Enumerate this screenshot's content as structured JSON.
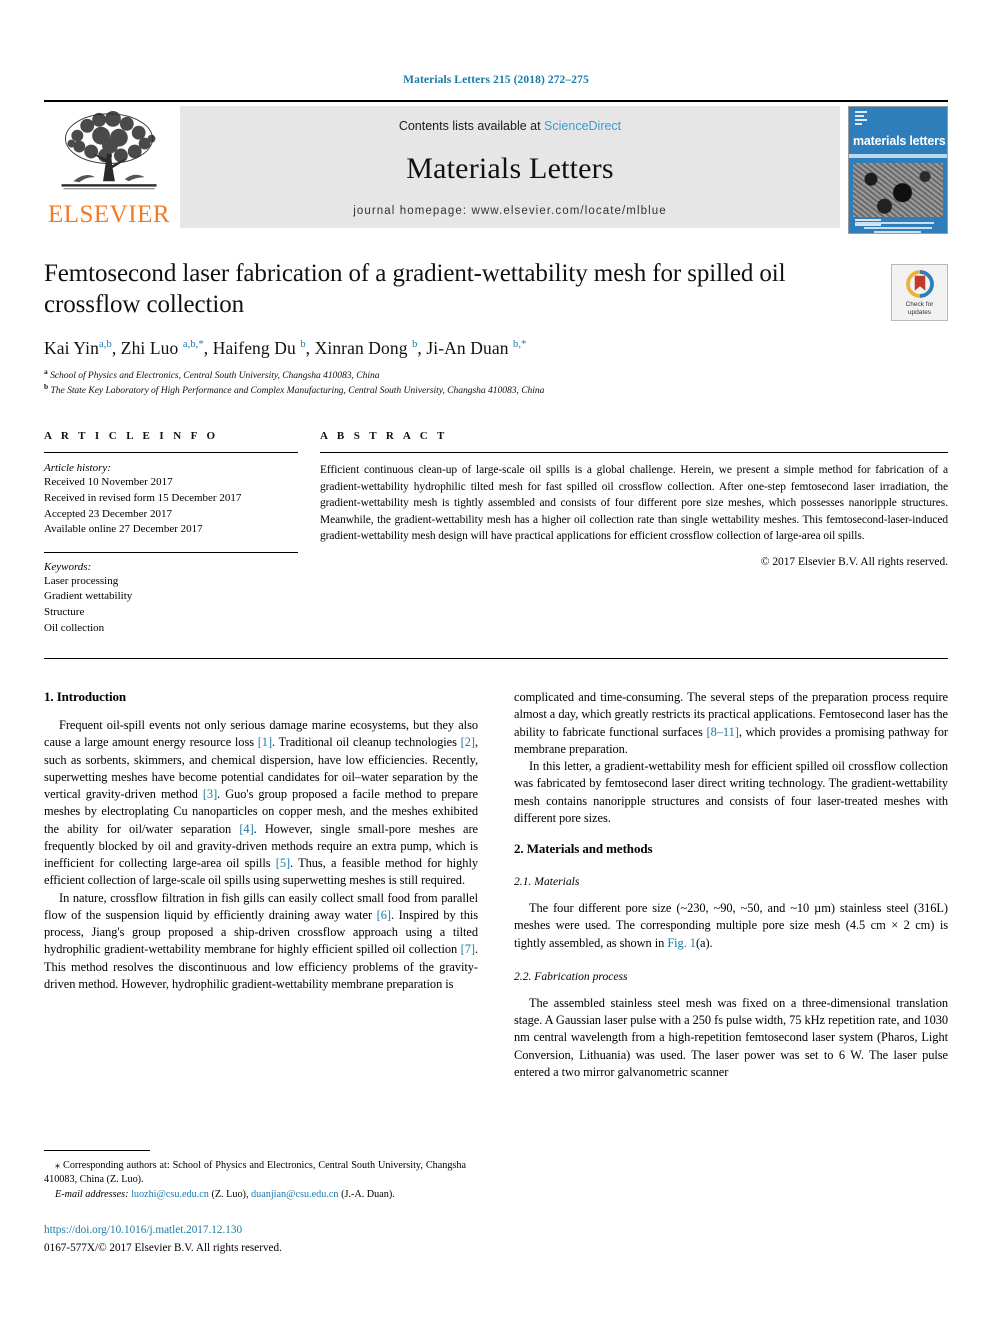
{
  "running_head": "Materials Letters 215 (2018) 272–275",
  "masthead": {
    "publisher_logo_text": "ELSEVIER",
    "contents_prefix": "Contents lists available at ",
    "sciencedirect": "ScienceDirect",
    "journal_name": "Materials Letters",
    "homepage": "journal homepage: www.elsevier.com/locate/mlblue",
    "cover_title": "materials letters"
  },
  "crossmark": {
    "line1": "Check for",
    "line2": "updates"
  },
  "article": {
    "title": "Femtosecond laser fabrication of a gradient-wettability mesh for spilled oil crossflow collection",
    "authors_html": "Kai Yin a,b, Zhi Luo a,b,*, Haifeng Du b, Xinran Dong b, Ji-An Duan b,*",
    "affiliation_a": "School of Physics and Electronics, Central South University, Changsha 410083, China",
    "affiliation_b": "The State Key Laboratory of High Performance and Complex Manufacturing, Central South University, Changsha 410083, China"
  },
  "article_info": {
    "heading": "A R T I C L E   I N F O",
    "history_label": "Article history:",
    "history": [
      "Received 10 November 2017",
      "Received in revised form 15 December 2017",
      "Accepted 23 December 2017",
      "Available online 27 December 2017"
    ],
    "keywords_label": "Keywords:",
    "keywords": [
      "Laser processing",
      "Gradient wettability",
      "Structure",
      "Oil collection"
    ]
  },
  "abstract": {
    "heading": "A B S T R A C T",
    "text": "Efficient continuous clean-up of large-scale oil spills is a global challenge. Herein, we present a simple method for fabrication of a gradient-wettability hydrophilic tilted mesh for fast spilled oil crossflow collection. After one-step femtosecond laser irradiation, the gradient-wettability mesh is tightly assembled and consists of four different pore size meshes, which possesses nanoripple structures. Meanwhile, the gradient-wettability mesh has a higher oil collection rate than single wettability meshes. This femtosecond-laser-induced gradient-wettability mesh design will have practical applications for efficient crossflow collection of large-area oil spills.",
    "copyright": "© 2017 Elsevier B.V. All rights reserved."
  },
  "body": {
    "left": {
      "section_heading": "1. Introduction",
      "paragraph_1_a": "Frequent oil-spill events not only serious damage marine ecosystems, but they also cause a large amount energy resource loss ",
      "ref1": "[1]",
      "paragraph_1_b": ". Traditional oil cleanup technologies ",
      "ref2": "[2]",
      "paragraph_1_c": ", such as sorbents, skimmers, and chemical dispersion, have low efficiencies. Recently, superwetting meshes have become potential candidates for oil–water separation by the vertical gravity-driven method ",
      "ref3": "[3]",
      "paragraph_1_d": ". Guo's group proposed a facile method to prepare meshes by electroplating Cu nanoparticles on copper mesh, and the meshes exhibited the ability for oil/water separation ",
      "ref4": "[4]",
      "paragraph_1_e": ". However, single small-pore meshes are frequently blocked by oil and gravity-driven methods require an extra pump, which is inefficient for collecting large-area oil spills ",
      "ref5": "[5]",
      "paragraph_1_f": ". Thus, a feasible method for highly efficient collection of large-scale oil spills using superwetting meshes is still required.",
      "paragraph_2_a": "In nature, crossflow filtration in fish gills can easily collect small food from parallel flow of the suspension liquid by efficiently draining away water ",
      "ref6": "[6]",
      "paragraph_2_b": ". Inspired by this process, Jiang's group proposed a ship-driven crossflow approach using a tilted hydrophilic gradient-wettability membrane for highly efficient spilled oil collection ",
      "ref7": "[7]",
      "paragraph_2_c": ". This method resolves the discontinuous and low efficiency problems of the gravity-driven method. However, hydrophilic gradient-wettability membrane preparation is"
    },
    "right": {
      "paragraph_1_a": "complicated and time-consuming. The several steps of the preparation process require almost a day, which greatly restricts its practical applications. Femtosecond laser has the ability to fabricate functional surfaces ",
      "ref8": "[8–11]",
      "paragraph_1_b": ", which provides a promising pathway for membrane preparation.",
      "paragraph_2": "In this letter, a gradient-wettability mesh for efficient spilled oil crossflow collection was fabricated by femtosecond laser direct writing technology. The gradient-wettability mesh contains nanoripple structures and consists of four laser-treated meshes with different pore sizes.",
      "section_heading": "2. Materials and methods",
      "sub_heading_1": "2.1. Materials",
      "paragraph_3_a": "The four different pore size (~230, ~90, ~50, and ~10 µm) stainless steel (316L) meshes were used. The corresponding multiple pore size mesh (4.5 cm × 2 cm) is tightly assembled, as shown in ",
      "fig_ref": "Fig. 1",
      "paragraph_3_b": "(a).",
      "sub_heading_2": "2.2. Fabrication process",
      "paragraph_4": "The assembled stainless steel mesh was fixed on a three-dimensional translation stage. A Gaussian laser pulse with a 250 fs pulse width, 75 kHz repetition rate, and 1030 nm central wavelength from a high-repetition femtosecond laser system (Pharos, Light Conversion, Lithuania) was used. The laser power was set to 6 W. The laser pulse entered a two mirror galvanometric scanner"
    }
  },
  "footnote": {
    "corresponding_a": "Corresponding authors at: School of Physics and Electronics, Central South University, Changsha 410083, China (Z. Luo).",
    "email_label": "E-mail addresses:",
    "email_1": "luozhi@csu.edu.cn",
    "email_1_who": "(Z. Luo),",
    "email_2": "duanjian@csu.edu.cn",
    "email_2_who": "(J.-A. Duan).",
    "doi": "https://doi.org/10.1016/j.matlet.2017.12.130",
    "issn": "0167-577X/© 2017 Elsevier B.V. All rights reserved."
  },
  "colors": {
    "link": "#1a7aa8",
    "elsevier_orange": "#f47920",
    "sciencedirect": "#3a9bd0",
    "cover_blue": "#2e7ebb"
  }
}
